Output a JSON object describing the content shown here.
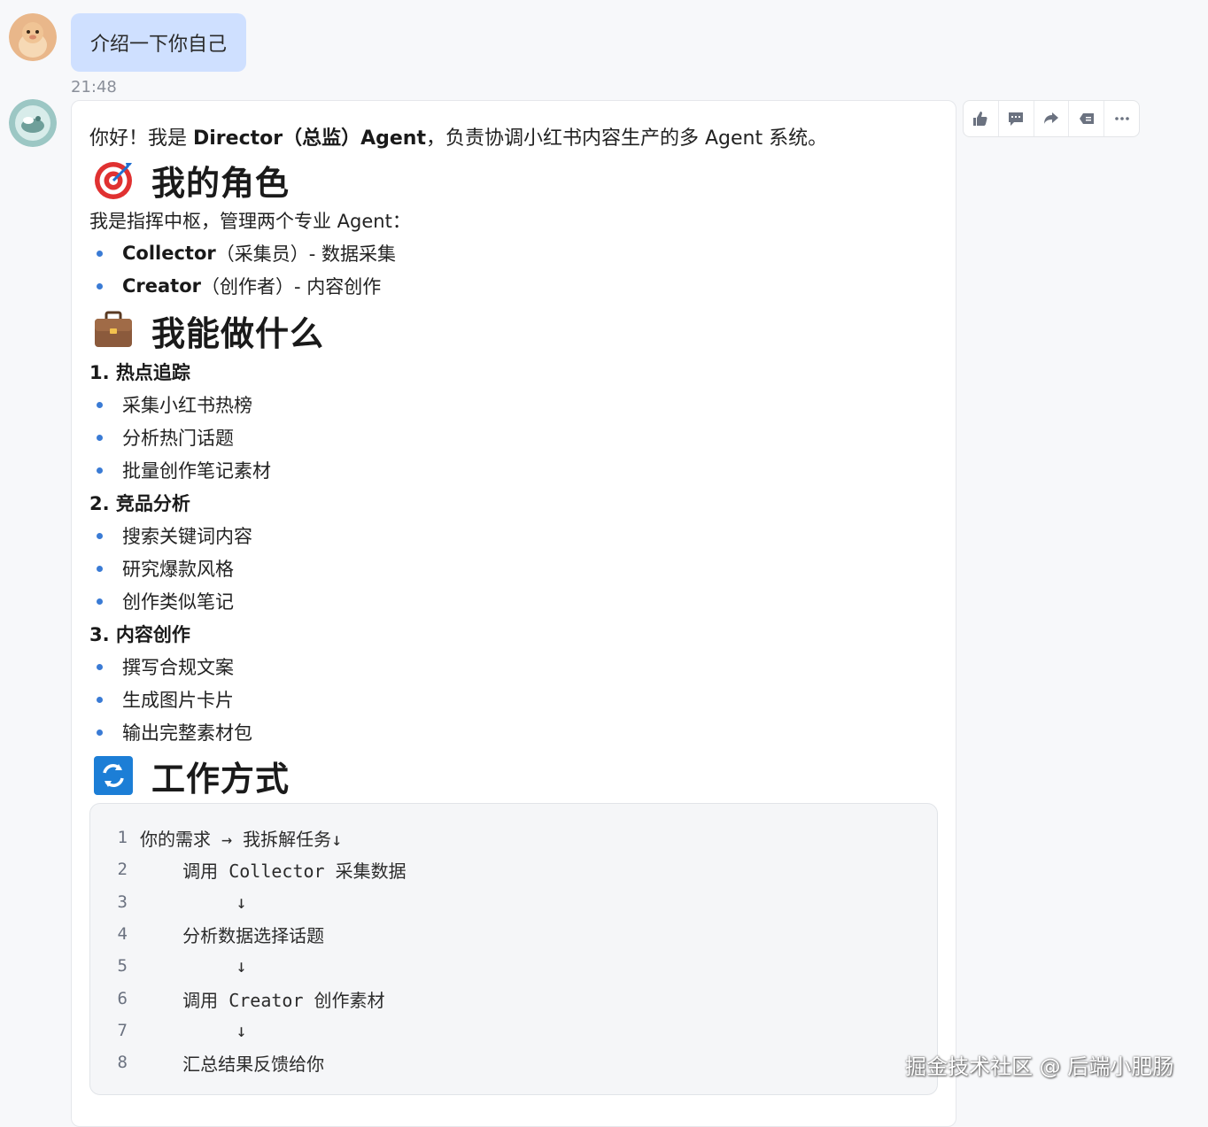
{
  "user_message": {
    "text": "介绍一下你自己",
    "time": "21:48"
  },
  "bot_message": {
    "intro": {
      "pre": "你好！我是 ",
      "name": "Director（总监）Agent",
      "post": "，负责协调小红书内容生产的多 Agent 系统。"
    },
    "sections": {
      "role": {
        "icon": "target-icon",
        "title": "我的角色"
      },
      "abilities": {
        "icon": "briefcase-icon",
        "title": "我能做什么"
      },
      "workflow": {
        "icon": "refresh-icon",
        "title": "工作方式"
      }
    },
    "role_intro": "我是指挥中枢，管理两个专业 Agent：",
    "agents": [
      {
        "name": "Collector",
        "desc": "（采集员）- 数据采集"
      },
      {
        "name": "Creator",
        "desc": "（创作者）- 内容创作"
      }
    ],
    "abilities": [
      {
        "title": "1. 热点追踪",
        "items": [
          "采集小红书热榜",
          "分析热门话题",
          "批量创作笔记素材"
        ]
      },
      {
        "title": "2. 竞品分析",
        "items": [
          "搜索关键词内容",
          "研究爆款风格",
          "创作类似笔记"
        ]
      },
      {
        "title": "3. 内容创作",
        "items": [
          "撰写合规文案",
          "生成图片卡片",
          "输出完整素材包"
        ]
      }
    ],
    "code_lines": [
      {
        "n": "1",
        "text": "你的需求 → 我拆解任务↓"
      },
      {
        "n": "2",
        "text": "    调用 Collector 采集数据"
      },
      {
        "n": "3",
        "text": "         ↓"
      },
      {
        "n": "4",
        "text": "    分析数据选择话题"
      },
      {
        "n": "5",
        "text": "         ↓"
      },
      {
        "n": "6",
        "text": "    调用 Creator 创作素材"
      },
      {
        "n": "7",
        "text": "         ↓"
      },
      {
        "n": "8",
        "text": "    汇总结果反馈给你"
      }
    ]
  },
  "toolbar": {
    "buttons": [
      "thumbs-up-icon",
      "comment-icon",
      "share-icon",
      "delete-icon",
      "more-icon"
    ]
  },
  "watermark": "掘金技术社区 @ 后端小肥肠",
  "colors": {
    "user_bubble": "#cfe0ff",
    "bullet": "#3a7bd5",
    "code_bg": "#f5f6f8"
  }
}
